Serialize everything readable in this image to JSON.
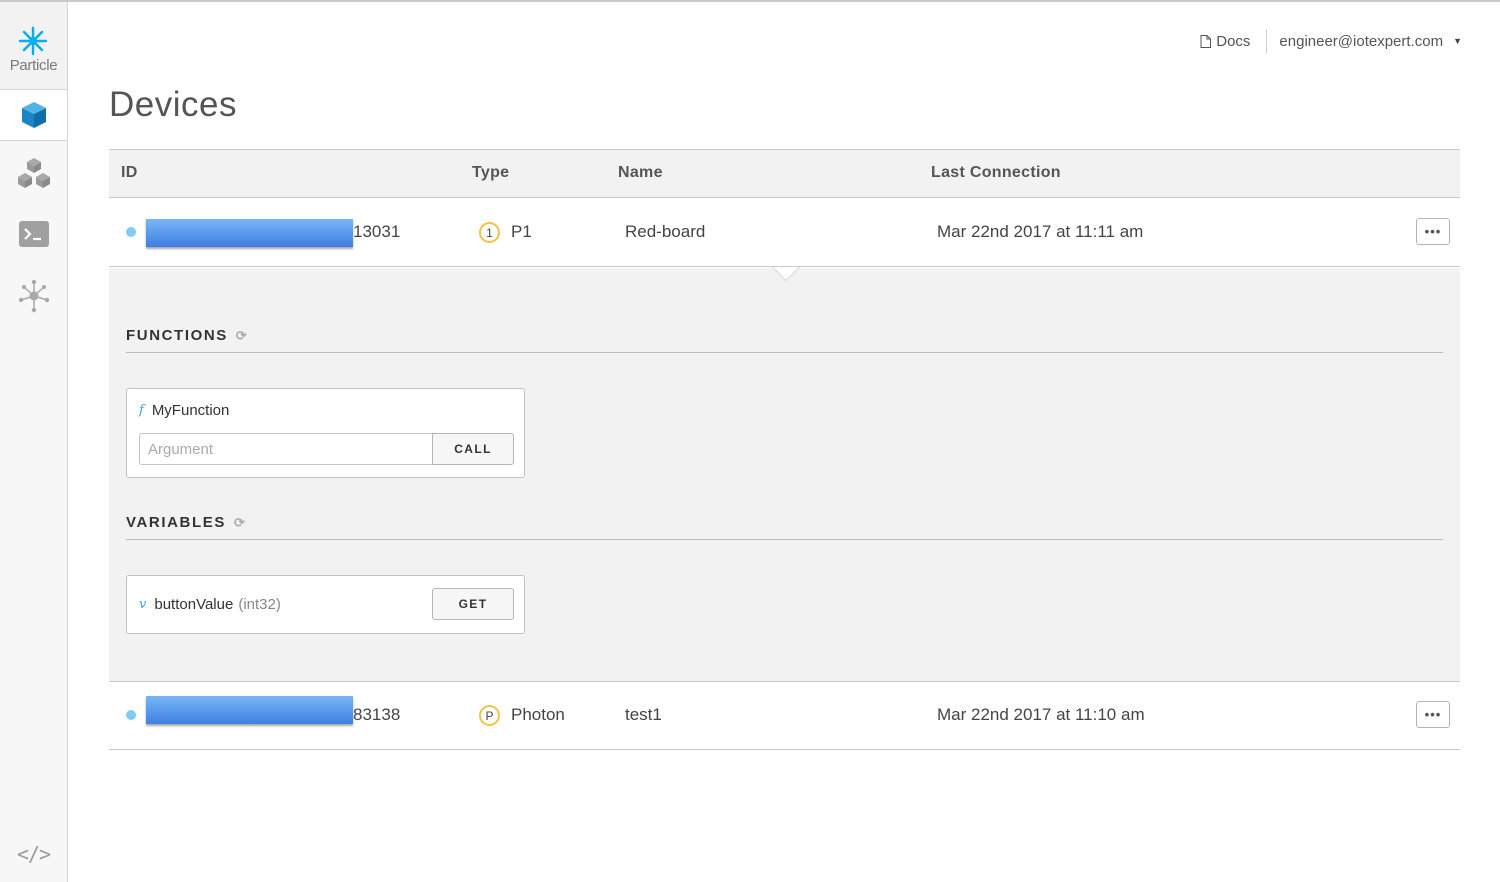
{
  "brand": {
    "name": "Particle"
  },
  "sidebar": {
    "items": [
      {
        "icon": "device-cube-icon",
        "active": true
      },
      {
        "icon": "products-cubes-icon",
        "active": false
      },
      {
        "icon": "console-icon",
        "active": false
      },
      {
        "icon": "integrations-hub-icon",
        "active": false
      }
    ],
    "bottom_icon": "code-icon",
    "bottom_label": "</>"
  },
  "header": {
    "docs_label": "Docs",
    "user_email": "engineer@iotexpert.com"
  },
  "page": {
    "title": "Devices"
  },
  "table": {
    "columns": [
      "ID",
      "Type",
      "Name",
      "Last Connection"
    ],
    "rows": [
      {
        "id_suffix": "13031",
        "type_badge": "1",
        "type": "P1",
        "name": "Red-board",
        "last_connection": "Mar 22nd 2017 at 11:11 am",
        "online": true,
        "more_label": "•••"
      },
      {
        "id_suffix": "83138",
        "type_badge": "P",
        "type": "Photon",
        "name": "test1",
        "last_connection": "Mar 22nd 2017 at 11:10 am",
        "online": true,
        "more_label": "•••"
      }
    ]
  },
  "panel": {
    "functions_title": "FUNCTIONS",
    "functions": [
      {
        "symbol": "f",
        "name": "MyFunction",
        "argument_placeholder": "Argument",
        "call_label": "CALL"
      }
    ],
    "variables_title": "VARIABLES",
    "variables": [
      {
        "symbol": "v",
        "name": "buttonValue",
        "type": "(int32)",
        "get_label": "GET"
      }
    ]
  },
  "colors": {
    "accent": "#2ca6e0",
    "online_dot": "#7fcdf1",
    "badge_ring": "#f4c244"
  }
}
